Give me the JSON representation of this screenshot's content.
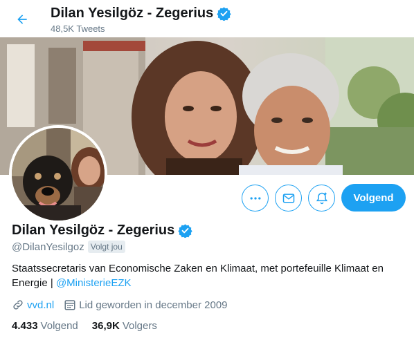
{
  "header": {
    "title": "Dilan Yesilgöz - Zegerius",
    "tweet_count": "48,5K Tweets"
  },
  "profile": {
    "name": "Dilan Yesilgöz - Zegerius",
    "handle": "@DilanYesilgoz",
    "follows_you_badge": "Volgt jou",
    "bio_text": "Staatssecretaris van Economische Zaken en Klimaat, met portefeuille Klimaat en Energie | ",
    "bio_mention": "@MinisterieEZK",
    "website": "vvd.nl",
    "joined": "Lid geworden in december 2009"
  },
  "stats": {
    "following_count": "4.433",
    "following_label": "Volgend",
    "followers_count": "36,9K",
    "followers_label": "Volgers"
  },
  "actions": {
    "follow_label": "Volgend"
  },
  "colors": {
    "accent": "#1da1f2",
    "text": "#14171a",
    "secondary_text": "#657786"
  }
}
